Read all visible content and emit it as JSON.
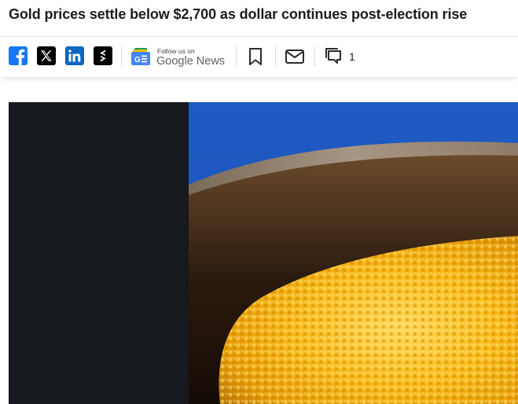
{
  "article": {
    "headline": "Gold prices settle below $2,700 as dollar continues post-election rise"
  },
  "share_bar": {
    "social": [
      {
        "name": "facebook",
        "icon": "facebook-icon",
        "color": "#1877f2"
      },
      {
        "name": "x",
        "icon": "x-icon",
        "color": "#000000"
      },
      {
        "name": "linkedin",
        "icon": "linkedin-icon",
        "color": "#0a66c2"
      },
      {
        "name": "stocktwits",
        "icon": "stocktwits-icon",
        "color": "#000000"
      }
    ],
    "google_news": {
      "small_text": "Follow us on",
      "big_text": "Google News"
    },
    "bookmark_icon": "bookmark-icon",
    "mail_icon": "mail-icon",
    "comments": {
      "icon": "comments-icon",
      "count": "1"
    }
  },
  "hero_image": {
    "description_icon": "gold-granules-photo"
  }
}
